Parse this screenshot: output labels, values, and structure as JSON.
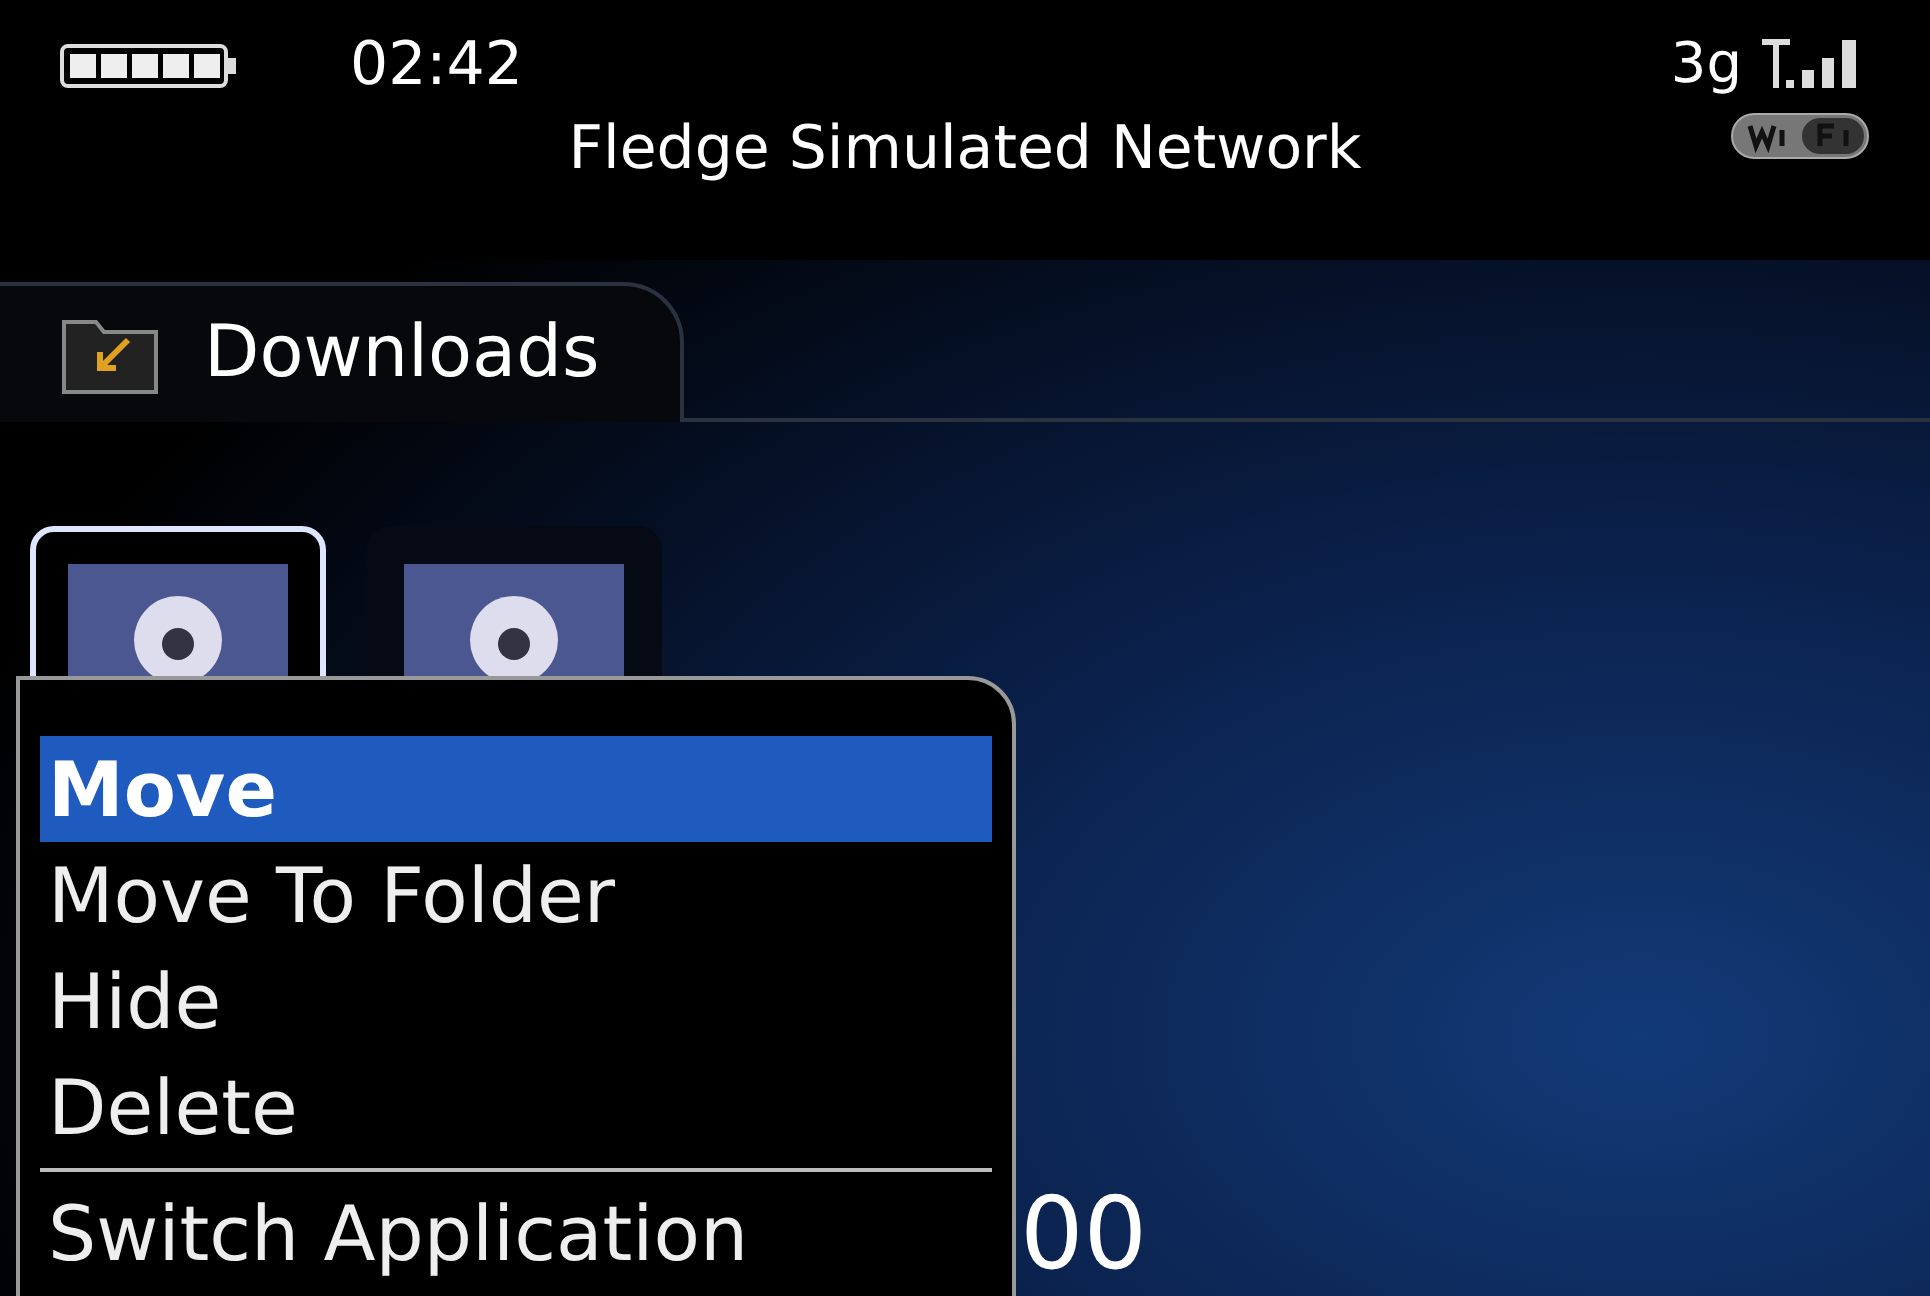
{
  "status_bar": {
    "time": "02:42",
    "network": "Fledge Simulated Network",
    "signal_type": "3g"
  },
  "header": {
    "title": "Downloads"
  },
  "thumbnails": [
    {
      "selected": true
    },
    {
      "selected": false
    }
  ],
  "background_label": "00",
  "menu": {
    "items": [
      {
        "label": "Move",
        "selected": true,
        "separator_before": false
      },
      {
        "label": "Move To Folder",
        "selected": false,
        "separator_before": false
      },
      {
        "label": "Hide",
        "selected": false,
        "separator_before": false
      },
      {
        "label": "Delete",
        "selected": false,
        "separator_before": false
      },
      {
        "label": "Switch Application",
        "selected": false,
        "separator_before": true
      }
    ]
  }
}
